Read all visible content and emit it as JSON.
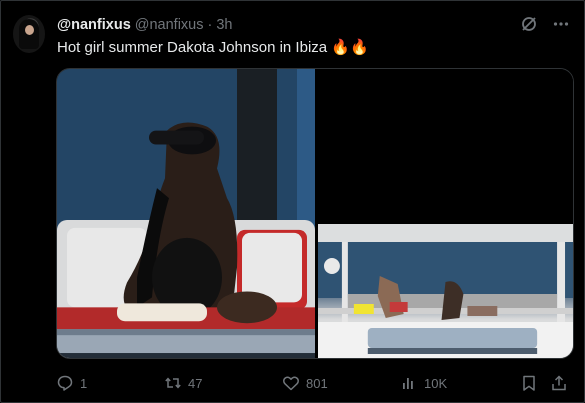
{
  "tweet": {
    "display_name": "@nanfixus",
    "handle": "@nanfixus",
    "separator": "·",
    "time": "3h",
    "text": "Hot girl summer Dakota  Johnson in Ibiza 🔥🔥"
  },
  "media": {
    "left_photo_icon": "photo-icon",
    "right_photo_icon": "photo-icon"
  },
  "actions": {
    "replies": "1",
    "retweets": "47",
    "likes": "801",
    "views": "10K"
  },
  "colors": {
    "background": "#000000",
    "text": "#e7e9ea",
    "muted": "#71767b",
    "border": "#2f3336"
  }
}
